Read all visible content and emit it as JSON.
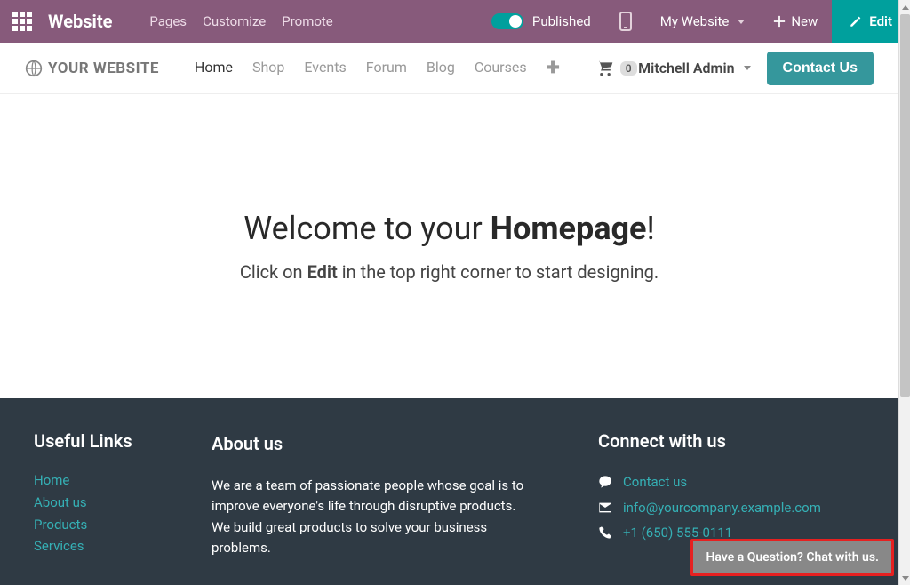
{
  "adminbar": {
    "app_name": "Website",
    "links": {
      "pages": "Pages",
      "customize": "Customize",
      "promote": "Promote"
    },
    "published": "Published",
    "my_website": "My Website",
    "new": "New",
    "edit": "Edit"
  },
  "sitenav": {
    "logo_text": "YOUR WEBSITE",
    "items": [
      "Home",
      "Shop",
      "Events",
      "Forum",
      "Blog",
      "Courses"
    ],
    "active_index": 0,
    "cart_count": "0",
    "user": "Mitchell Admin",
    "contact_label": "Contact Us"
  },
  "hero": {
    "title_prefix": "Welcome to your ",
    "title_strong": "Homepage",
    "title_suffix": "!",
    "subtitle_prefix": "Click on ",
    "subtitle_strong": "Edit",
    "subtitle_suffix": " in the top right corner to start designing."
  },
  "footer": {
    "links_heading": "Useful Links",
    "links": [
      "Home",
      "About us",
      "Products",
      "Services"
    ],
    "about_heading": "About us",
    "about_text": "We are a team of passionate people whose goal is to improve everyone's life through disruptive products. We build great products to solve your business problems.",
    "connect_heading": "Connect with us",
    "contact_us": "Contact us",
    "email": "info@yourcompany.example.com",
    "phone": "+1 (650) 555-0111"
  },
  "chat_label": "Have a Question? Chat with us."
}
